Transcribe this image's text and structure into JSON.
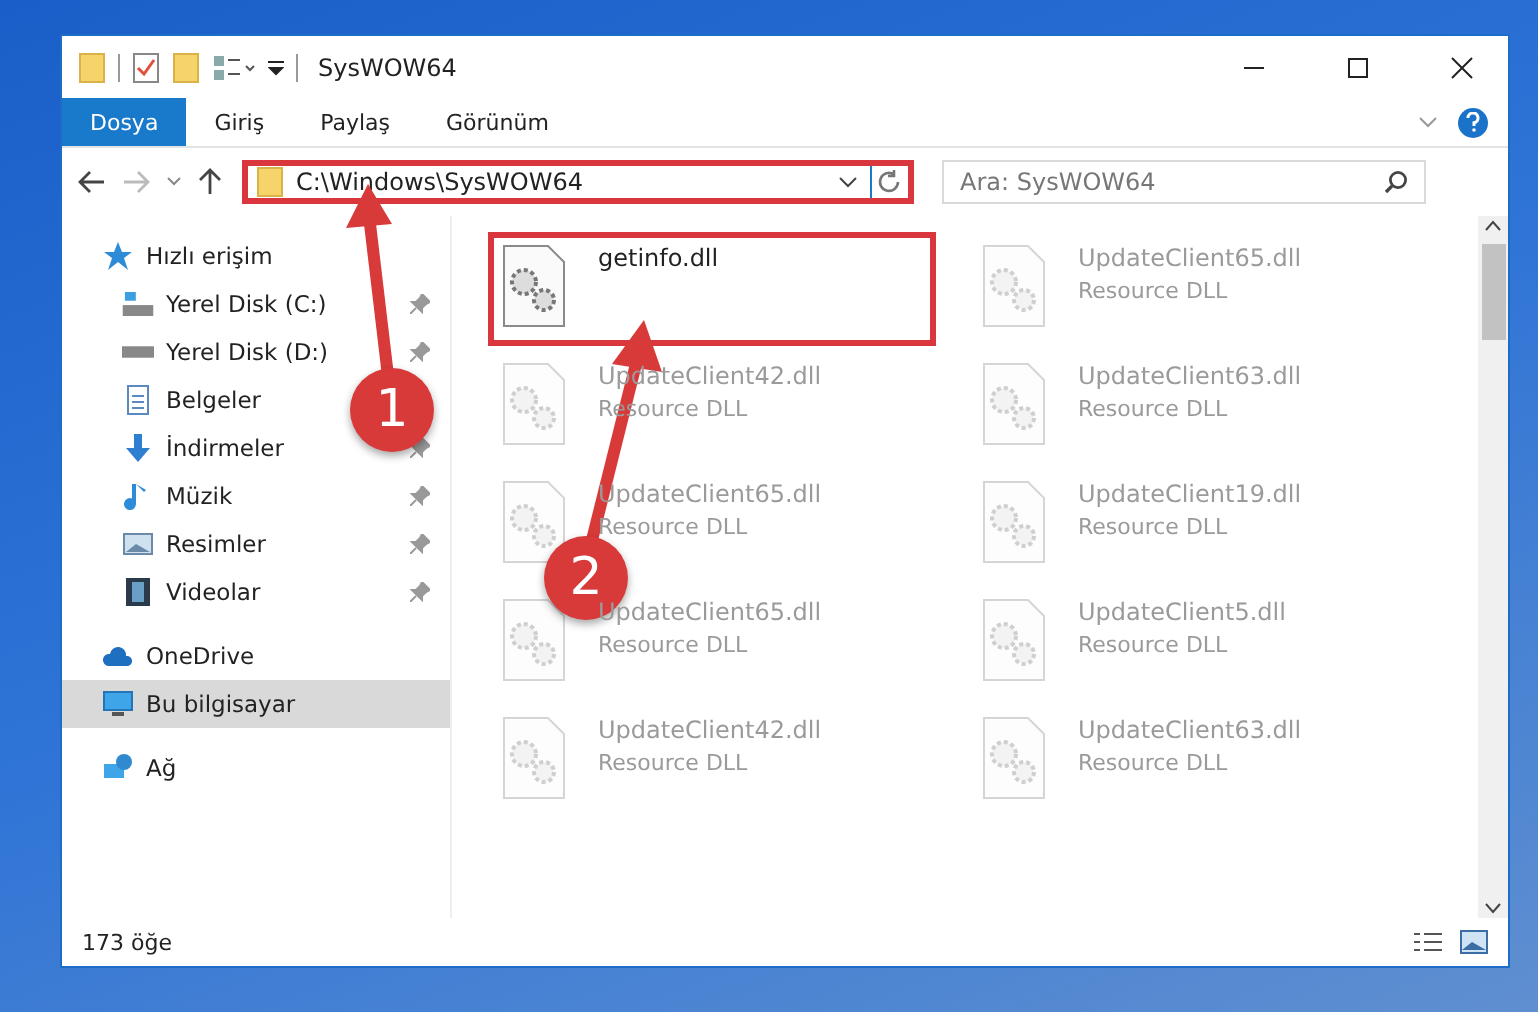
{
  "window": {
    "title": "SysWOW64"
  },
  "ribbon": {
    "tabs": [
      {
        "label": "Dosya",
        "kind": "file",
        "selected": true
      },
      {
        "label": "Giriş",
        "kind": "tab",
        "selected": false
      },
      {
        "label": "Paylaş",
        "kind": "tab",
        "selected": false
      },
      {
        "label": "Görünüm",
        "kind": "tab",
        "selected": false
      }
    ]
  },
  "address": {
    "path": "C:\\Windows\\SysWOW64"
  },
  "search": {
    "placeholder": "Ara: SysWOW64"
  },
  "sidebar": {
    "items": [
      {
        "label": "Hızlı erişim",
        "kind": "star",
        "selected": false,
        "children": [
          {
            "label": "Yerel Disk (C:)",
            "kind": "drive-c",
            "selected": false
          },
          {
            "label": "Yerel Disk (D:)",
            "kind": "drive",
            "selected": false
          },
          {
            "label": "Belgeler",
            "kind": "docs",
            "selected": false
          },
          {
            "label": "İndirmeler",
            "kind": "download",
            "selected": false
          },
          {
            "label": "Müzik",
            "kind": "music",
            "selected": false
          },
          {
            "label": "Resimler",
            "kind": "pictures",
            "selected": false
          },
          {
            "label": "Videolar",
            "kind": "videos",
            "selected": false
          }
        ]
      },
      {
        "label": "OneDrive",
        "kind": "cloud",
        "selected": false
      },
      {
        "label": "Bu bilgisayar",
        "kind": "pc",
        "selected": true
      },
      {
        "label": "Ağ",
        "kind": "network",
        "selected": false
      }
    ]
  },
  "files": [
    {
      "name": "getinfo.dll",
      "faded": false,
      "highlighted": true
    },
    {
      "name": "UpdateClient65.dll",
      "type": "Resource DLL",
      "faded": true
    },
    {
      "name": "UpdateClient42.dll",
      "type": "Resource DLL",
      "faded": true
    },
    {
      "name": "UpdateClient63.dll",
      "type": "Resource DLL",
      "faded": true
    },
    {
      "name": "UpdateClient65.dll",
      "type": "Resource DLL",
      "faded": true
    },
    {
      "name": "UpdateClient19.dll",
      "type": "Resource DLL",
      "faded": true
    },
    {
      "name": "UpdateClient65.dll",
      "type": "Resource DLL",
      "faded": true
    },
    {
      "name": "UpdateClient5.dll",
      "type": "Resource DLL",
      "faded": true
    },
    {
      "name": "UpdateClient42.dll",
      "type": "Resource DLL",
      "faded": true
    },
    {
      "name": "UpdateClient63.dll",
      "type": "Resource DLL",
      "faded": true
    }
  ],
  "status_bar": {
    "count": "173 öğe"
  },
  "annotations": [
    {
      "number": "1"
    },
    {
      "number": "2"
    }
  ]
}
